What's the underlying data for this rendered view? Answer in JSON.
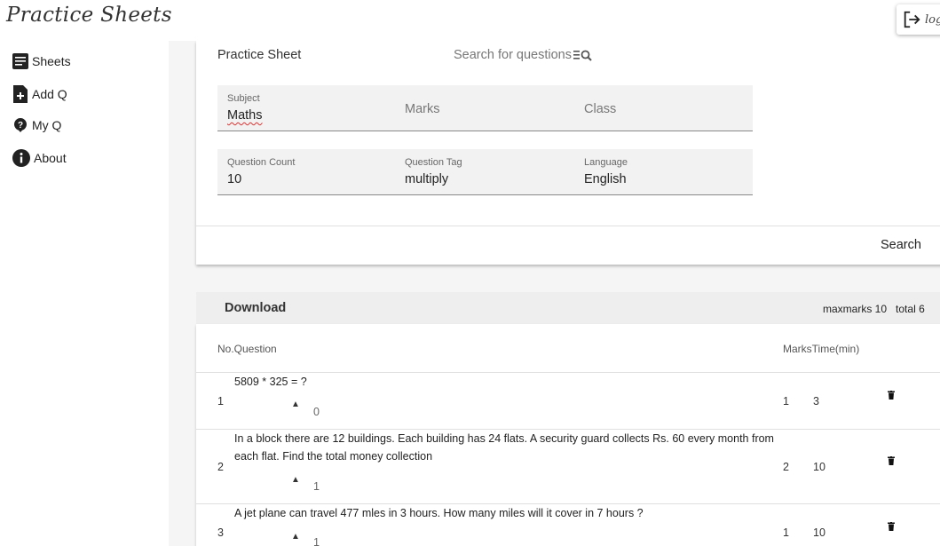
{
  "app": {
    "title": "Practice Sheets",
    "logout_label": "log"
  },
  "sidebar": {
    "items": [
      {
        "label": "Sheets",
        "icon": "sheets-icon"
      },
      {
        "label": "Add Q",
        "icon": "add-document-icon"
      },
      {
        "label": "My Q",
        "icon": "question-bubble-icon"
      },
      {
        "label": "About",
        "icon": "info-icon"
      }
    ]
  },
  "form": {
    "title": "Practice Sheet",
    "search_placeholder": "Search for questions",
    "subject": {
      "label": "Subject",
      "value": "Maths"
    },
    "marks": {
      "placeholder": "Marks"
    },
    "class": {
      "placeholder": "Class"
    },
    "question_count": {
      "label": "Question Count",
      "value": "10"
    },
    "question_tag": {
      "label": "Question Tag",
      "value": "multiply"
    },
    "language": {
      "label": "Language",
      "value": "English"
    },
    "search_button": "Search"
  },
  "results": {
    "download_label": "Download",
    "maxmarks": "maxmarks 10",
    "total": "total 6",
    "headers": {
      "no_question": "No.Question",
      "marks_time": "MarksTime(min)"
    },
    "rows": [
      {
        "no": "1",
        "question": "5809 * 325 = ?",
        "votes": "0",
        "marks": "1",
        "time": "3"
      },
      {
        "no": "2",
        "question": "In a block there are 12 buildings. Each building has 24 flats. A security guard collects Rs. 60 every month from each flat. Find the total money collection",
        "votes": "1",
        "marks": "2",
        "time": "10"
      },
      {
        "no": "3",
        "question": "A jet plane can travel 477 mles in 3 hours. How many miles will it cover in 7 hours ?",
        "votes": "1",
        "marks": "1",
        "time": "10"
      }
    ]
  }
}
